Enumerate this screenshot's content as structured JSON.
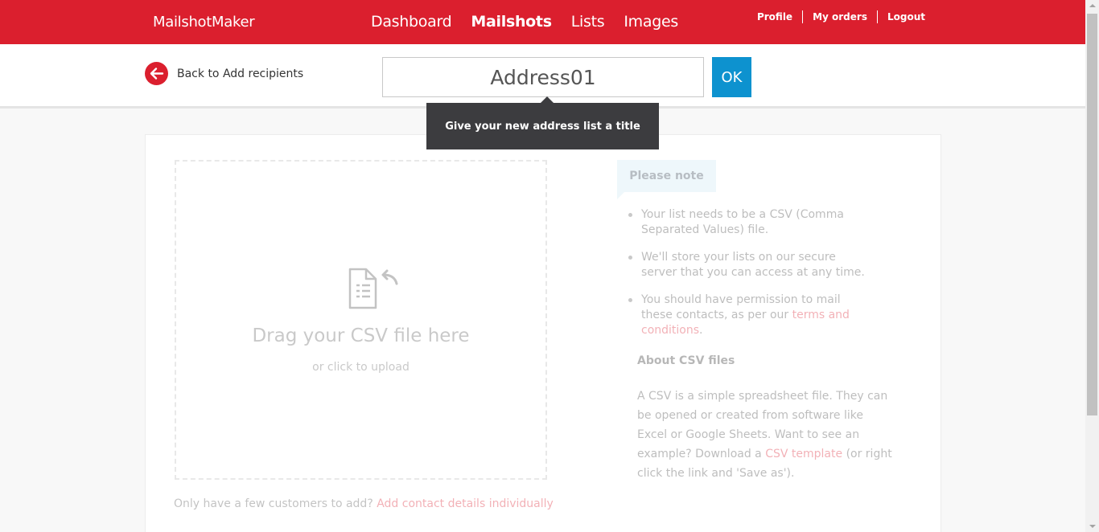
{
  "header": {
    "logo": "MailshotMaker",
    "nav": [
      {
        "label": "Dashboard",
        "active": false
      },
      {
        "label": "Mailshots",
        "active": true
      },
      {
        "label": "Lists",
        "active": false
      },
      {
        "label": "Images",
        "active": false
      }
    ],
    "user_nav": [
      "Profile",
      "My orders",
      "Logout"
    ]
  },
  "subbar": {
    "back_label": "Back to Add recipients",
    "back_icon": "arrow-left-icon",
    "title_value": "Address01",
    "ok_label": "OK",
    "tooltip": "Give your new address list a title"
  },
  "upload": {
    "icon": "upload-file-icon",
    "title": "Drag your CSV file here",
    "subtitle": "or click to upload",
    "few_prefix": "Only have a few customers to add?",
    "few_link": "Add contact details individually"
  },
  "note": {
    "tab": "Please note",
    "item1": "Your list needs to be a CSV (Comma Separated Values) file.",
    "item2": "We'll store your lists on our secure server that you can access at any time.",
    "item3_prefix": "You should have permission to mail these contacts, as per our",
    "item3_link": "terms and conditions",
    "item3_suffix": "."
  },
  "about": {
    "heading": "About CSV files",
    "text_prefix": "A CSV is a simple spreadsheet file. They can be opened or created from software like Excel or Google Sheets. Want to see an example? Download a",
    "link": "CSV template",
    "text_suffix": "(or right click the link and 'Save as')."
  },
  "colors": {
    "brand_red": "#db1f2e",
    "ok_blue": "#0d92cf",
    "tooltip_bg": "#3c3c3f",
    "note_tab_bg": "#cde9f4"
  }
}
